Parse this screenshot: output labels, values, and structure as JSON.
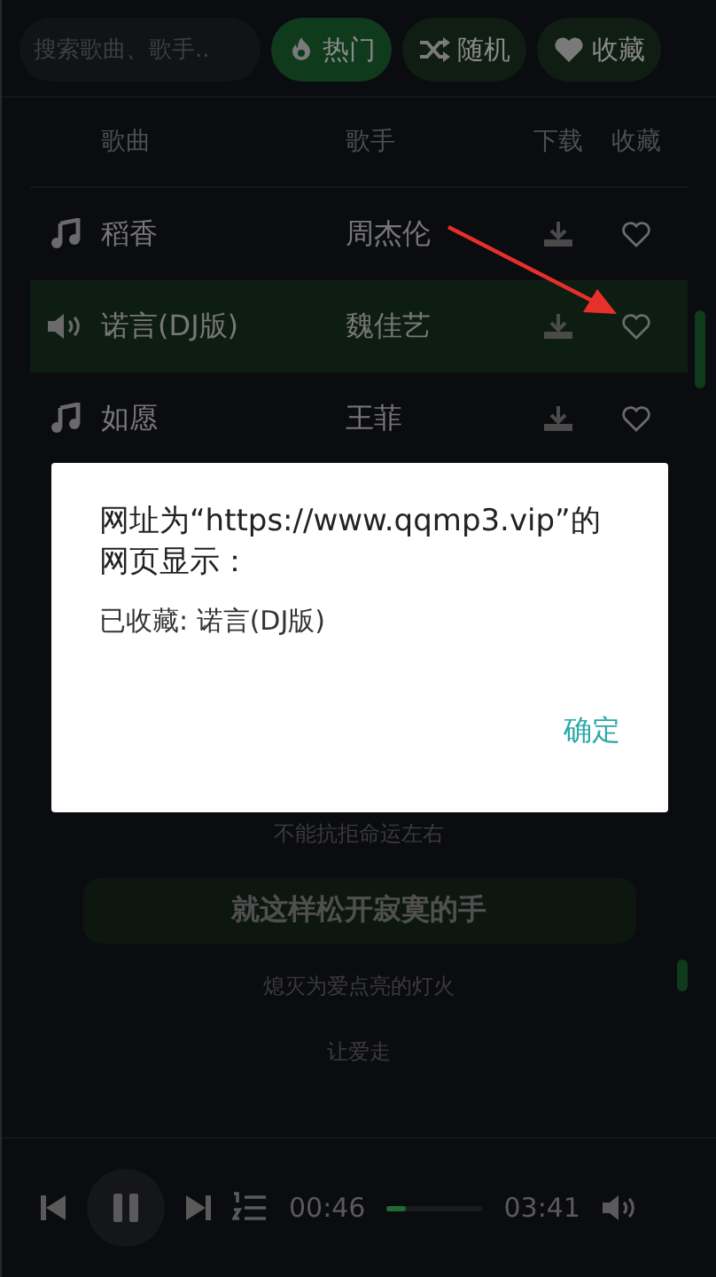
{
  "search": {
    "placeholder": "搜索歌曲、歌手.."
  },
  "filters": [
    {
      "label": "热门",
      "kind": "hot",
      "selected": true
    },
    {
      "label": "随机",
      "kind": "random",
      "selected": false
    },
    {
      "label": "收藏",
      "kind": "favorites",
      "selected": false
    }
  ],
  "table": {
    "columns": [
      "歌曲",
      "歌手",
      "下载",
      "收藏"
    ],
    "rows": [
      {
        "song": "稻香",
        "artist": "周杰伦",
        "playing": false
      },
      {
        "song": "诺言(DJ版)",
        "artist": "魏佳艺",
        "playing": true
      },
      {
        "song": "如愿",
        "artist": "王菲",
        "playing": false
      }
    ]
  },
  "lyrics": [
    {
      "text": "不能抗拒命运左右",
      "current": false
    },
    {
      "text": "就这样松开寂寞的手",
      "current": true
    },
    {
      "text": "熄灭为爱点亮的灯火",
      "current": false
    },
    {
      "text": "让爱走",
      "current": false
    }
  ],
  "player": {
    "playing": true,
    "elapsed": "00:46",
    "progress": {
      "level": 0.2
    },
    "duration": "03:41"
  },
  "dialog": {
    "title": "网址为“https://www.qqmp3.vip”的网页显示：",
    "message": "已收藏: 诺言(DJ版)",
    "button": "确定"
  }
}
